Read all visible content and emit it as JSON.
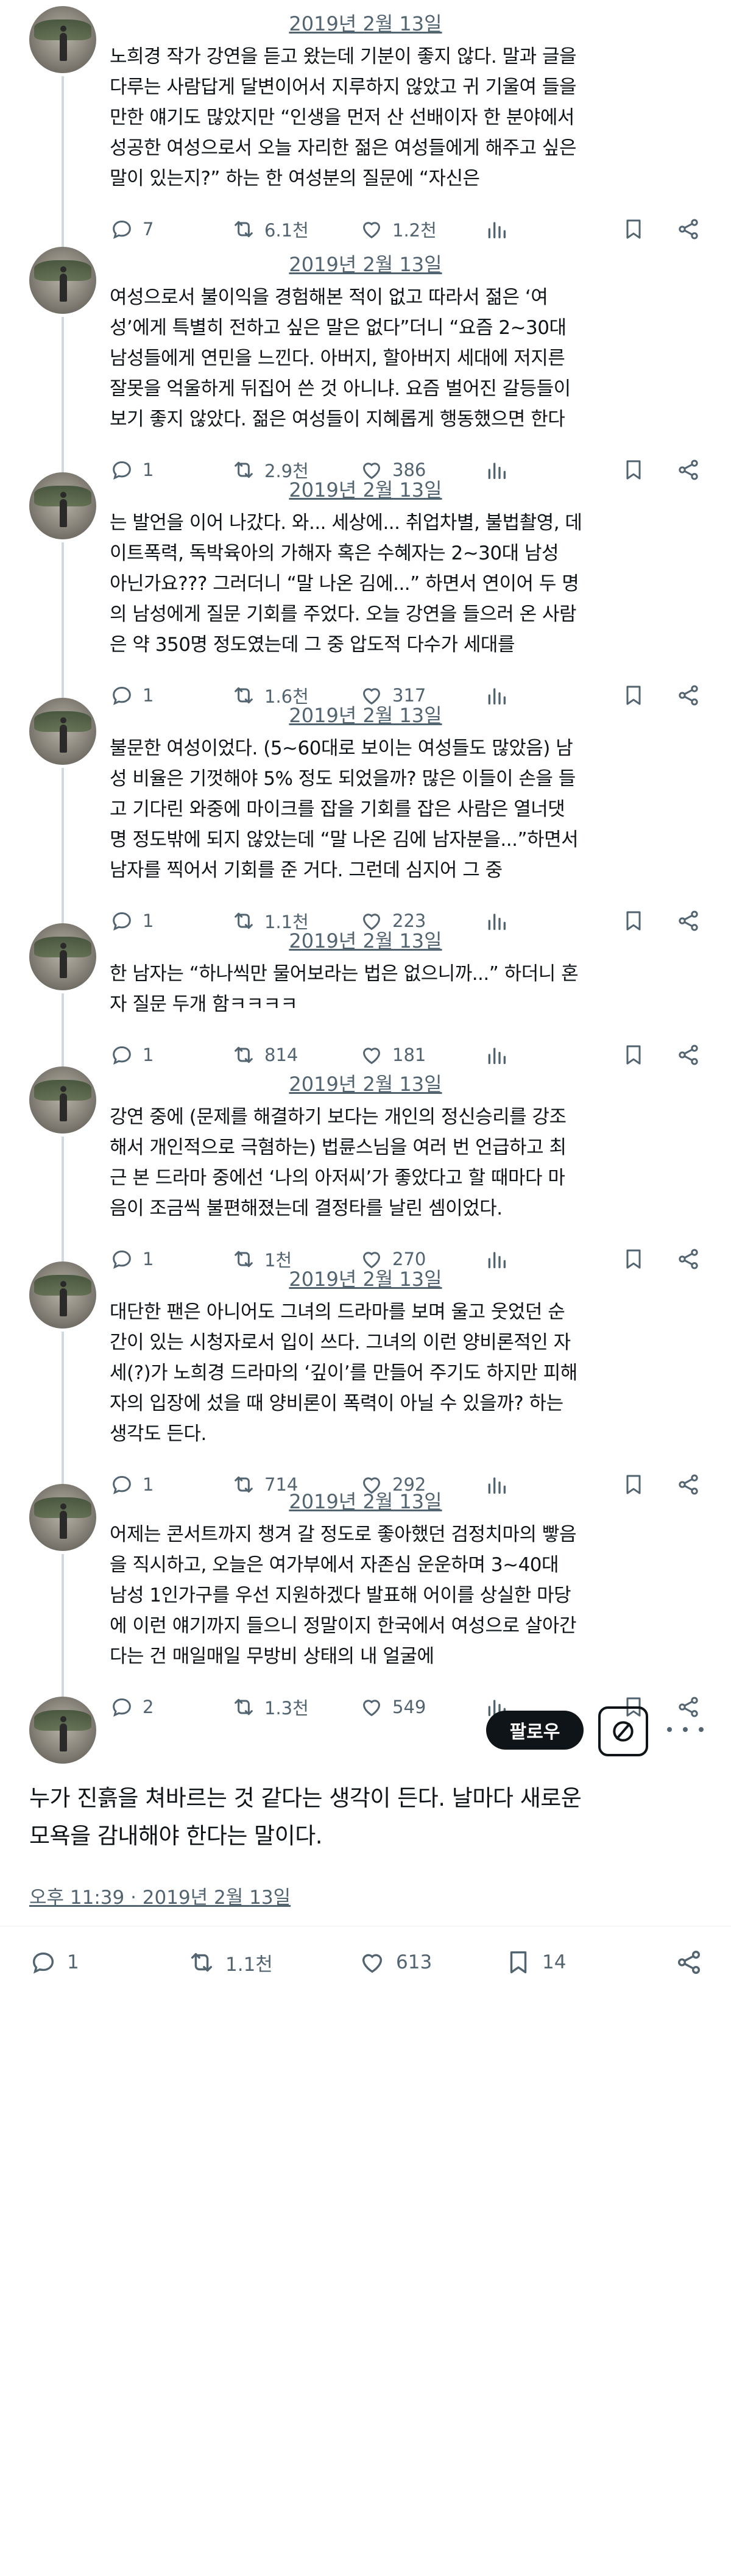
{
  "thread": [
    {
      "date": "2019년 2월 13일",
      "lines": [
        "노희경 작가 강연을 듣고 왔는데 기분이 좋지 않다. 말과 글을",
        "다루는 사람답게 달변이어서 지루하지 않았고 귀 기울여 들을",
        "만한 얘기도 많았지만 “인생을 먼저 산 선배이자 한 분야에서",
        "성공한 여성으로서 오늘 자리한 젊은 여성들에게 해주고 싶은",
        "말이 있는지?” 하는 한 여성분의 질문에 “자신은"
      ],
      "replies": "7",
      "retweets": "6.1천",
      "likes": "1.2천"
    },
    {
      "date": "2019년 2월 13일",
      "lines": [
        "여성으로서 불이익을 경험해본 적이 없고 따라서 젊은 ‘여",
        "성’에게 특별히 전하고 싶은 말은 없다”더니 “요즘 2~30대",
        "남성들에게 연민을 느낀다. 아버지, 할아버지 세대에 저지른",
        "잘못을 억울하게 뒤집어 쓴 것 아니냐. 요즘 벌어진 갈등들이",
        "보기 좋지 않았다. 젊은 여성들이 지혜롭게 행동했으면 한다"
      ],
      "replies": "1",
      "retweets": "2.9천",
      "likes": "386"
    },
    {
      "date": "2019년 2월 13일",
      "lines": [
        "는 발언을 이어 나갔다. 와... 세상에... 취업차별, 불법촬영, 데",
        "이트폭력, 독박육아의 가해자 혹은 수혜자는 2~30대 남성",
        "아닌가요??? 그러더니 “말 나온 김에...” 하면서 연이어 두 명",
        "의 남성에게 질문 기회를 주었다. 오늘 강연을 들으러 온 사람",
        "은 약 350명 정도였는데 그 중 압도적 다수가 세대를"
      ],
      "replies": "1",
      "retweets": "1.6천",
      "likes": "317"
    },
    {
      "date": "2019년 2월 13일",
      "lines": [
        "불문한 여성이었다. (5~60대로 보이는 여성들도 많았음) 남",
        "성 비율은 기껏해야 5% 정도 되었을까? 많은 이들이 손을 들",
        "고 기다린 와중에 마이크를 잡을 기회를 잡은 사람은 열너댓",
        "명 정도밖에 되지 않았는데 “말 나온 김에 남자분을...”하면서",
        "남자를 찍어서 기회를 준 거다. 그런데 심지어 그 중"
      ],
      "replies": "1",
      "retweets": "1.1천",
      "likes": "223"
    },
    {
      "date": "2019년 2월 13일",
      "lines": [
        "한 남자는 “하나씩만 물어보라는 법은 없으니까...” 하더니 혼",
        "자 질문 두개 함ㅋㅋㅋㅋ"
      ],
      "replies": "1",
      "retweets": "814",
      "likes": "181"
    },
    {
      "date": "2019년 2월 13일",
      "lines": [
        "강연 중에 (문제를 해결하기 보다는 개인의 정신승리를 강조",
        "해서 개인적으로 극혐하는) 법륜스님을 여러 번 언급하고 최",
        "근 본 드라마 중에선 ‘나의 아저씨’가 좋았다고 할 때마다 마",
        "음이 조금씩 불편해졌는데 결정타를 날린 셈이었다."
      ],
      "replies": "1",
      "retweets": "1천",
      "likes": "270"
    },
    {
      "date": "2019년 2월 13일",
      "lines": [
        "대단한 팬은 아니어도 그녀의 드라마를 보며 울고 웃었던 순",
        "간이 있는 시청자로서 입이 쓰다. 그녀의 이런 양비론적인 자",
        "세(?)가 노희경 드라마의 ‘깊이’를 만들어 주기도 하지만 피해",
        "자의 입장에 섰을 때 양비론이 폭력이 아닐 수 있을까? 하는",
        "생각도 든다."
      ],
      "replies": "1",
      "retweets": "714",
      "likes": "292"
    },
    {
      "date": "2019년 2월 13일",
      "lines": [
        "어제는 콘서트까지 챙겨 갈 정도로 좋아했던 검정치마의 빻음",
        "을 직시하고, 오늘은 여가부에서 자존심 운운하며 3~40대",
        "남성 1인가구를 우선 지원하겠다 발표해 어이를 상실한 마당",
        "에 이런 얘기까지 들으니 정말이지 한국에서 여성으로 살아간",
        "다는 건 매일매일 무방비 상태의 내 얼굴에"
      ],
      "replies": "2",
      "retweets": "1.3천",
      "likes": "549"
    }
  ],
  "focused": {
    "follow_label": "팔로우",
    "lines": [
      "누가 진흙을 쳐바르는 것 같다는 생각이 든다. 날마다 새로운",
      "모욕을 감내해야 한다는 말이다."
    ],
    "meta": "오후 11:39 · 2019년 2월 13일",
    "replies": "1",
    "retweets": "1.1천",
    "likes": "613",
    "bookmarks": "14"
  },
  "icons": [
    "reply-icon",
    "retweet-icon",
    "like-icon",
    "views-icon",
    "bookmark-icon",
    "share-icon",
    "grok-icon",
    "more-icon"
  ]
}
